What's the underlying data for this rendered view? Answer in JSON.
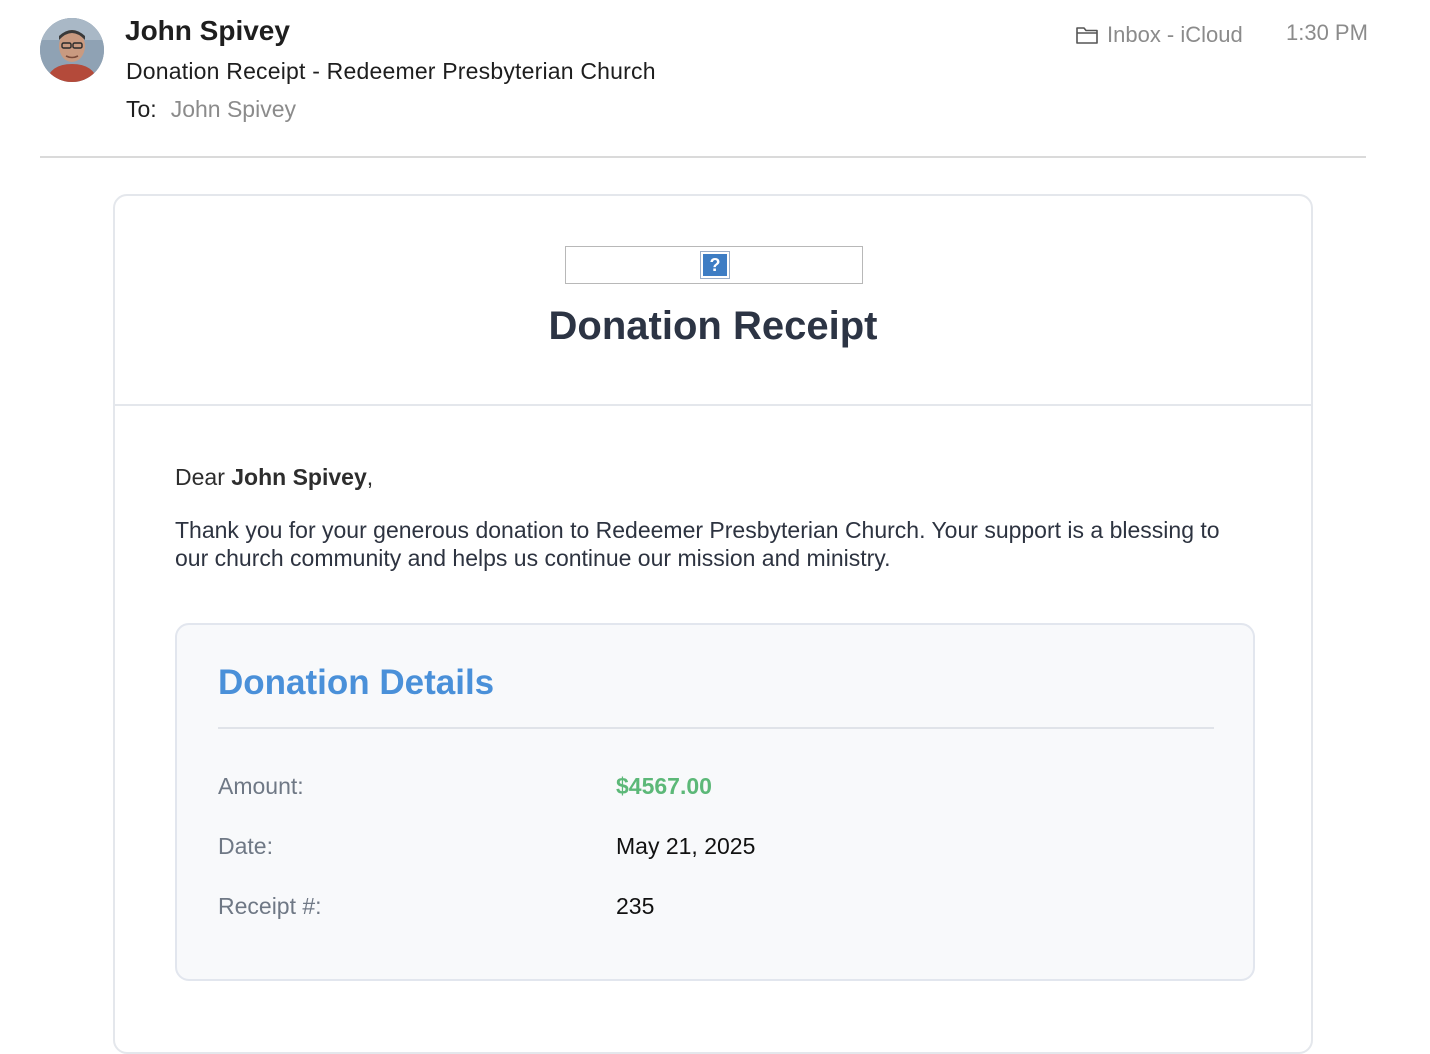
{
  "email": {
    "sender_name": "John Spivey",
    "subject": "Donation Receipt - Redeemer Presbyterian Church",
    "to_label": "To:",
    "to_name": "John Spivey",
    "mailbox": "Inbox - iCloud",
    "time": "1:30 PM",
    "folder_icon": "folder-icon",
    "avatar_icon": "avatar-photo"
  },
  "receipt": {
    "logo_placeholder": "?",
    "title": "Donation Receipt",
    "greeting_prefix": "Dear ",
    "greeting_name": "John Spivey",
    "greeting_suffix": ",",
    "message": "Thank you for your generous donation to Redeemer Presbyterian Church. Your support is a blessing to our church community and helps us continue our mission and ministry."
  },
  "details": {
    "title": "Donation Details",
    "rows": [
      {
        "label": "Amount:",
        "value": "$4567.00"
      },
      {
        "label": "Date:",
        "value": "May 21, 2025"
      },
      {
        "label": "Receipt #:",
        "value": "235"
      }
    ]
  },
  "colors": {
    "accent_blue": "#4a90d9",
    "amount_green": "#5cb878",
    "title_dark": "#2c3444"
  }
}
